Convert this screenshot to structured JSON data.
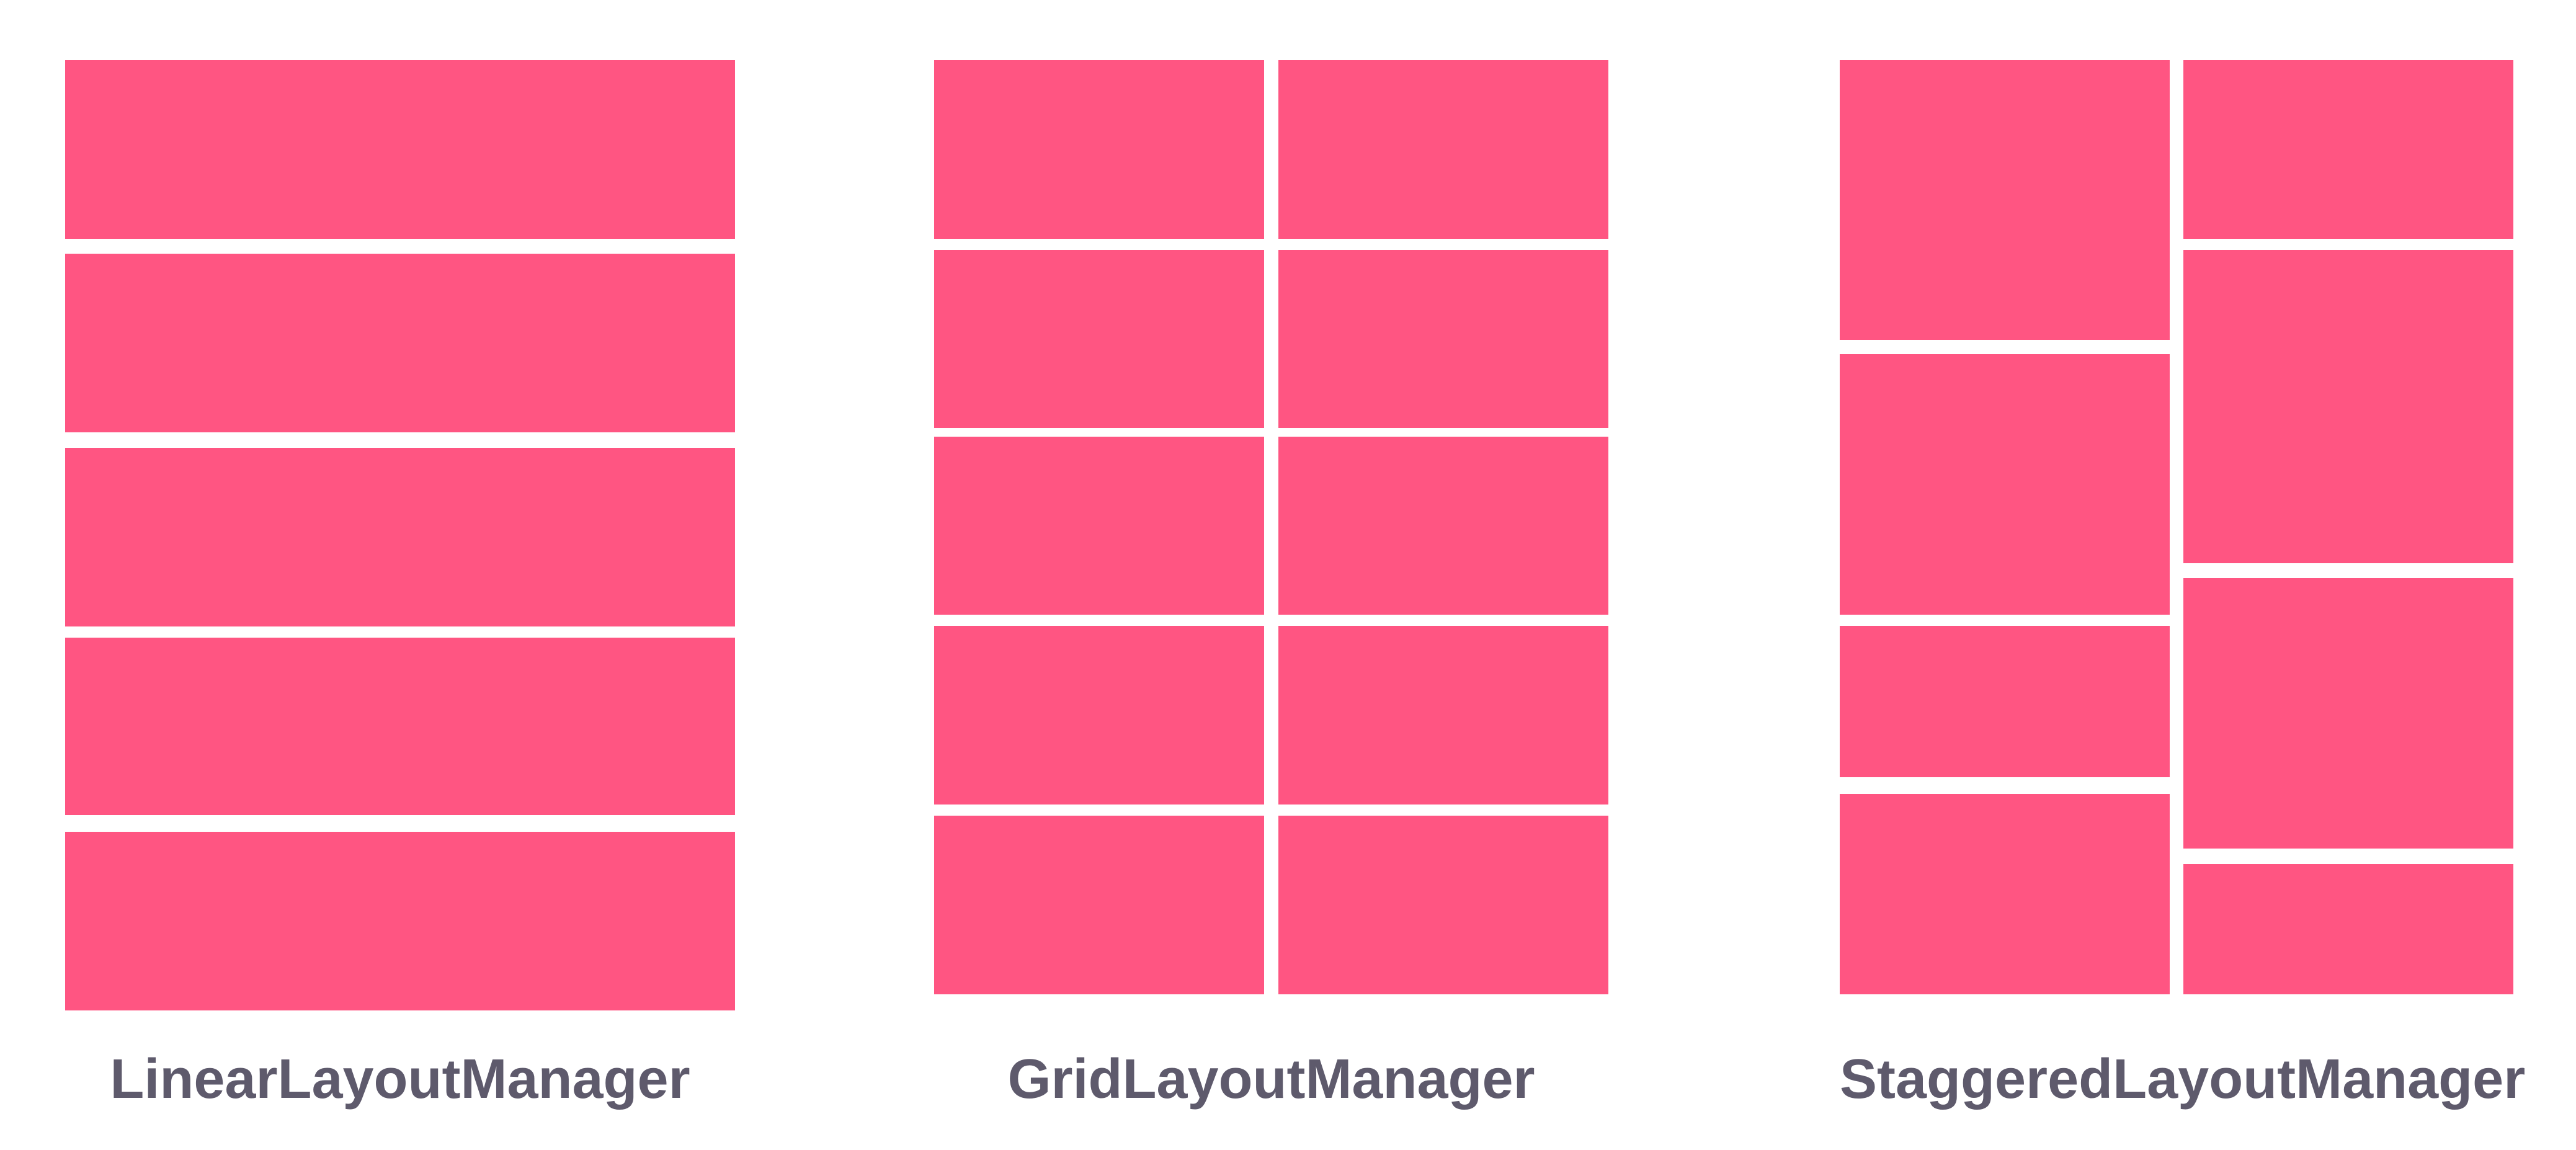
{
  "colors": {
    "item_fill": "#ff5582",
    "caption_text": "#5e5a6c",
    "background": "#ffffff"
  },
  "panels": [
    {
      "caption": "LinearLayoutManager",
      "columns": 1,
      "items_per_column": [
        5
      ]
    },
    {
      "caption": "GridLayoutManager",
      "columns": 2,
      "items_per_column": [
        5,
        5
      ]
    },
    {
      "caption": "StaggeredLayoutManager",
      "columns": 2,
      "items_per_column": [
        4,
        4
      ]
    }
  ]
}
